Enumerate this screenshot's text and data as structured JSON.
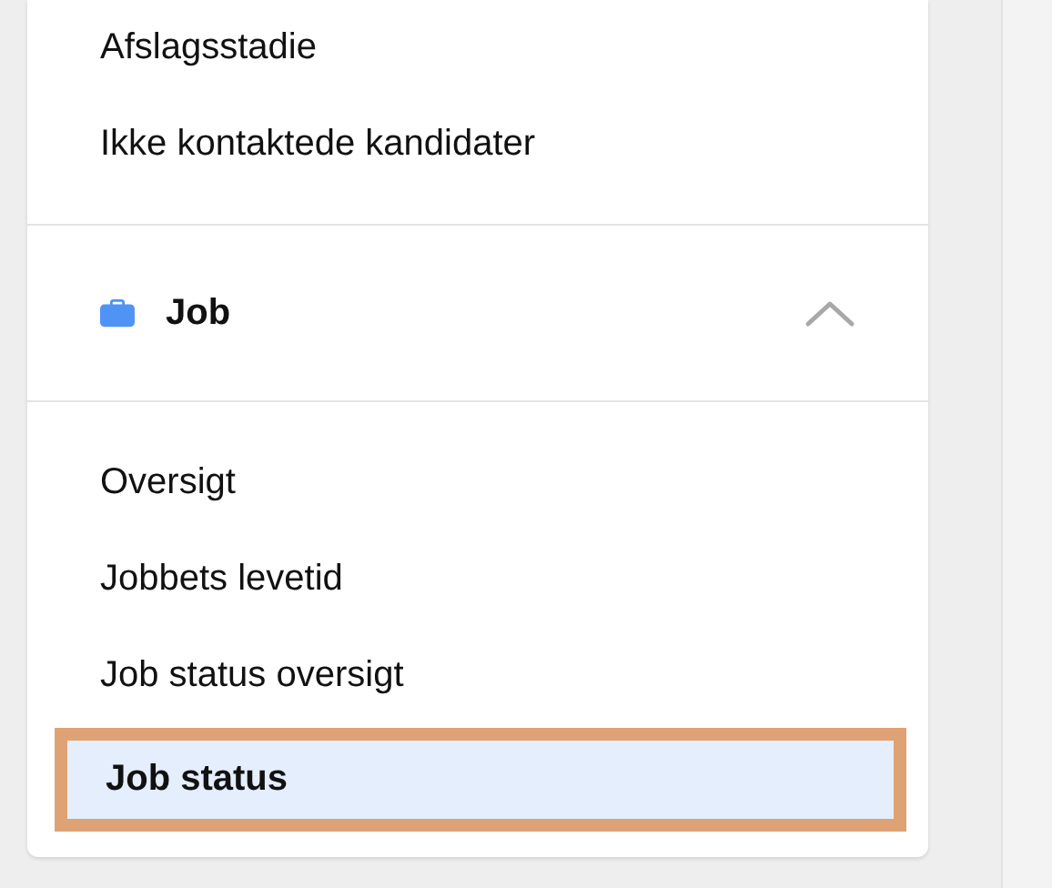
{
  "menu_items": [
    {
      "label": "Afslagsstadie",
      "selected": false
    },
    {
      "label": "Ikke kontaktede kandidater",
      "selected": false
    }
  ],
  "section": {
    "title": "Job",
    "expanded": true,
    "items": [
      {
        "label": "Oversigt",
        "selected": false
      },
      {
        "label": "Jobbets levetid",
        "selected": false
      },
      {
        "label": "Job status oversigt",
        "selected": false
      },
      {
        "label": "Job status",
        "selected": true
      }
    ]
  }
}
